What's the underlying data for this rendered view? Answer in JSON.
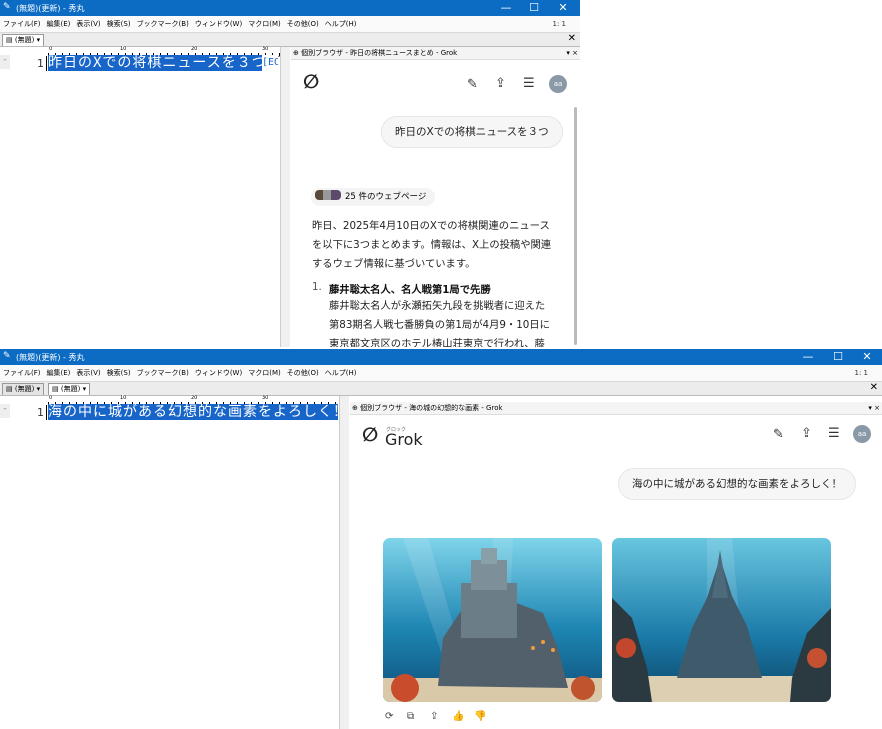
{
  "window1": {
    "title": "(無題)(更新) - 秀丸",
    "controls": {
      "minimize": "—",
      "maximize": "☐",
      "close": "✕"
    },
    "cursor_pos": "1: 1",
    "menu": [
      "ファイル(F)",
      "編集(E)",
      "表示(V)",
      "検索(S)",
      "ブックマーク(B)",
      "ウィンドウ(W)",
      "マクロ(M)",
      "その他(O)",
      "ヘルプ(H)"
    ],
    "tabs": [
      {
        "label": "(無題)",
        "dropdown": "▾"
      }
    ],
    "tab_close": "✕",
    "ruler": {
      "marks": [
        "0",
        "10",
        "20",
        "30",
        "40"
      ]
    },
    "editor": {
      "line_number": "1",
      "text": "昨日のXでの将棋ニュースを３つ",
      "eol_mark": "[EOF]"
    },
    "browser": {
      "title": "個別ブラウザ - 昨日の将棋ニュースまとめ - Grok",
      "menu_arrow": "▾",
      "close": "×",
      "logo": "∅",
      "icons": [
        "edit-icon",
        "share-icon",
        "history-icon"
      ],
      "avatar": "aa",
      "user_message": "昨日のXでの将棋ニュースを３つ",
      "sources_label": "25 件のウェブページ",
      "answer_intro": [
        "昨日、2025年4月10日のXでの将棋関連のニュース",
        "を以下に3つまとめます。情報は、X上の投稿や関連",
        "するウェブ情報に基づいています。"
      ],
      "items": [
        {
          "number": "1.",
          "heading": "藤井聡太名人、名人戦第1局で先勝",
          "body": [
            "藤井聡太名人が永瀬拓矢九段を挑戦者に迎えた",
            "第83期名人戦七番勝負の第1局が4月9・10日に",
            "東京都文京区のホテル椿山荘東京で行われ、藤"
          ]
        }
      ]
    }
  },
  "window2": {
    "title": "(無題)(更新) - 秀丸",
    "controls": {
      "minimize": "—",
      "maximize": "☐",
      "close": "✕"
    },
    "cursor_pos": "1: 1",
    "menu": [
      "ファイル(F)",
      "編集(E)",
      "表示(V)",
      "検索(S)",
      "ブックマーク(B)",
      "ウィンドウ(W)",
      "マクロ(M)",
      "その他(O)",
      "ヘルプ(H)"
    ],
    "tabs": [
      {
        "label": "(無題)",
        "dropdown": "▾"
      },
      {
        "label": "(無題)",
        "dropdown": "▾"
      }
    ],
    "tab_close": "✕",
    "ruler": {
      "marks": [
        "0",
        "10",
        "20",
        "30"
      ]
    },
    "editor": {
      "line_number": "1",
      "text": "海の中に城がある幻想的な画素をよろしく！"
    },
    "browser": {
      "title": "個別ブラウザ - 海の城の幻想的な画素 - Grok",
      "menu_arrow": "▾",
      "close": "×",
      "logo": "∅",
      "logo_word": "Grok",
      "logo_ruby": "グロック",
      "icons": [
        "edit-icon",
        "share-icon",
        "history-icon"
      ],
      "avatar": "aa",
      "user_message": "海の中に城がある幻想的な画素をよろしく！",
      "image_icons": [
        "refresh-icon",
        "copy-icon",
        "share-icon",
        "thumbs-up-icon",
        "thumbs-down-icon"
      ]
    }
  },
  "colors": {
    "titlebar": "#0c6cc4",
    "selection": "#1865c9"
  }
}
